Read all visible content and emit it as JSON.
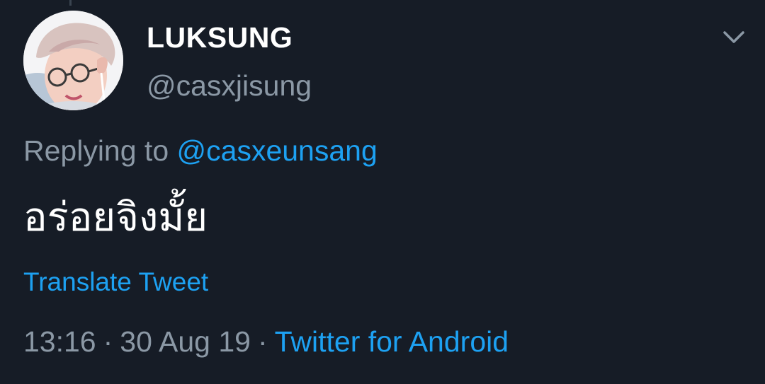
{
  "tweet": {
    "author": {
      "display_name": "LUKSUNG",
      "handle": "@casxjisung"
    },
    "reply": {
      "prefix": "Replying to",
      "handle": "@casxeunsang"
    },
    "text": "อร่อยจิงมั้ย",
    "translate_label": "Translate Tweet",
    "time": "13:16",
    "date": "30 Aug 19",
    "separator": "·",
    "source": "Twitter for Android"
  },
  "icons": {
    "menu": "chevron-down-icon",
    "avatar": "profile-photo"
  },
  "colors": {
    "background": "#161c26",
    "primary_text": "#ffffff",
    "secondary_text": "#8b98a5",
    "link": "#1da1f2"
  }
}
